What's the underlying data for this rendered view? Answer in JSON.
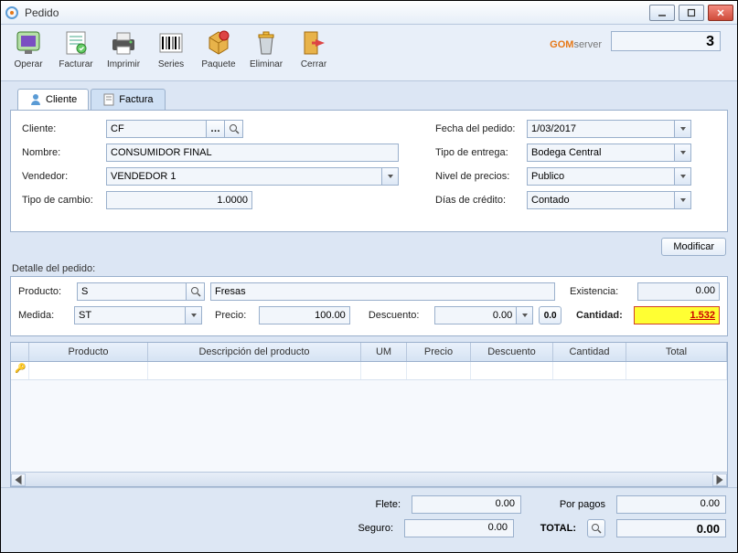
{
  "window": {
    "title": "Pedido"
  },
  "toolbar": {
    "operar": "Operar",
    "facturar": "Facturar",
    "imprimir": "Imprimir",
    "series": "Series",
    "paquete": "Paquete",
    "eliminar": "Eliminar",
    "cerrar": "Cerrar"
  },
  "brand": {
    "gom": "GOM",
    "server": "server",
    "num": "3"
  },
  "tabs": {
    "cliente": "Cliente",
    "factura": "Factura"
  },
  "form": {
    "cliente_lbl": "Cliente:",
    "cliente_val": "CF",
    "nombre_lbl": "Nombre:",
    "nombre_val": "CONSUMIDOR FINAL",
    "vendedor_lbl": "Vendedor:",
    "vendedor_val": "VENDEDOR 1",
    "tipocambio_lbl": "Tipo de cambio:",
    "tipocambio_val": "1.0000",
    "fecha_lbl": "Fecha del pedido:",
    "fecha_val": "1/03/2017",
    "tipoentrega_lbl": "Tipo de entrega:",
    "tipoentrega_val": "Bodega Central",
    "nivel_lbl": "Nivel de precios:",
    "nivel_val": "Publico",
    "dias_lbl": "Días de crédito:",
    "dias_val": "Contado"
  },
  "buttons": {
    "modificar": "Modificar",
    "zero": "0.0"
  },
  "detail": {
    "section": "Detalle del pedido:",
    "producto_lbl": "Producto:",
    "producto_code": "S",
    "producto_name": "Fresas",
    "existencia_lbl": "Existencia:",
    "existencia_val": "0.00",
    "medida_lbl": "Medida:",
    "medida_val": "ST",
    "precio_lbl": "Precio:",
    "precio_val": "100.00",
    "descuento_lbl": "Descuento:",
    "descuento_val": "0.00",
    "cantidad_lbl": "Cantidad:",
    "cantidad_val": "1.532"
  },
  "grid": {
    "cols": {
      "producto": "Producto",
      "descripcion": "Descripción del producto",
      "um": "UM",
      "precio": "Precio",
      "descuento": "Descuento",
      "cantidad": "Cantidad",
      "total": "Total"
    }
  },
  "footer": {
    "flete_lbl": "Flete:",
    "flete_val": "0.00",
    "seguro_lbl": "Seguro:",
    "seguro_val": "0.00",
    "porpagos_lbl": "Por pagos",
    "porpagos_val": "0.00",
    "total_lbl": "TOTAL:",
    "total_val": "0.00"
  }
}
